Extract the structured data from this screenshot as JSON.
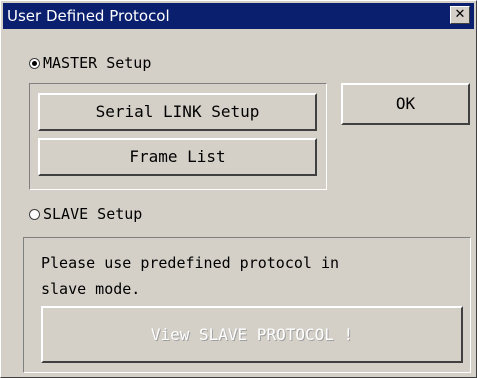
{
  "window": {
    "title": "User Defined Protocol",
    "close_glyph": "✕"
  },
  "master": {
    "radio_label": "MASTER Setup",
    "selected": true,
    "serial_link_button": "Serial LINK Setup",
    "frame_list_button": "Frame List"
  },
  "ok_button": "OK",
  "slave": {
    "radio_label": "SLAVE Setup",
    "selected": false,
    "message": "Please use predefined protocol in\nslave mode.",
    "view_protocol_button": "View SLAVE PROTOCOL !",
    "view_protocol_enabled": false
  },
  "colors": {
    "titlebar": "#0a1f6e",
    "dialog_face": "#d4d0c8"
  }
}
